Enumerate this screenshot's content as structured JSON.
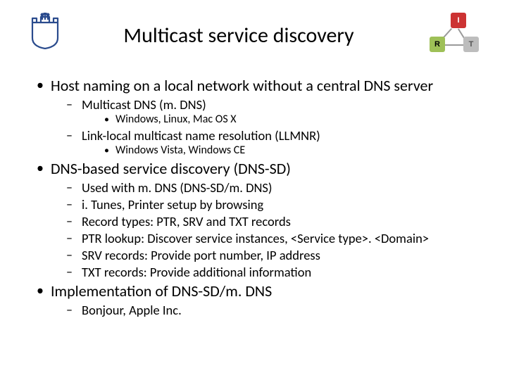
{
  "title": "Multicast service discovery",
  "diagram": {
    "i": "I",
    "r": "R",
    "t": "T"
  },
  "bullets": {
    "b1": "Host naming on a local network without a central DNS server",
    "b1_1": "Multicast DNS (m. DNS)",
    "b1_1_1": "Windows, Linux, Mac OS X",
    "b1_2": "Link-local multicast name resolution (LLMNR)",
    "b1_2_1": "Windows Vista, Windows CE",
    "b2": "DNS-based service discovery (DNS-SD)",
    "b2_1": "Used with m. DNS (DNS-SD/m. DNS)",
    "b2_2": "i. Tunes, Printer setup by browsing",
    "b2_3": "Record types: PTR, SRV and TXT records",
    "b2_4": "PTR lookup: Discover service instances, <Service type>. <Domain>",
    "b2_5": "SRV records: Provide port number, IP address",
    "b2_6": "TXT records: Provide additional information",
    "b3": "Implementation of DNS-SD/m. DNS",
    "b3_1": "Bonjour, Apple Inc."
  }
}
